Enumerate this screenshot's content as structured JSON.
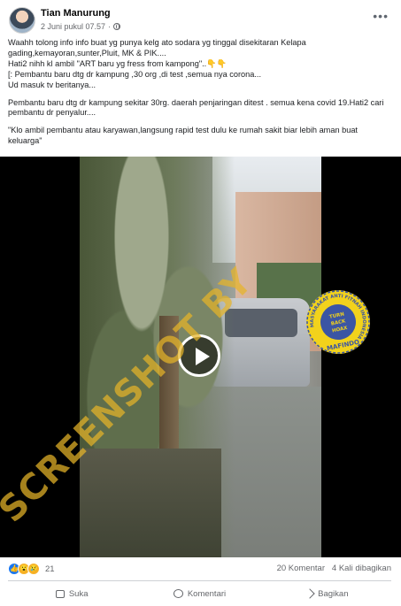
{
  "post": {
    "author": "Tian Manurung",
    "date": "2 Juni pukul 07.57",
    "date_separator": "·",
    "text_lines": [
      "Waahh tolong info info buat yg punya kelg ato sodara yg tinggal disekitaran Kelapa gading,kemayoran,sunter,Pluit, MK & PIK....",
      "Hati2 nihh kl ambil \"ART baru yg fress from kampong\"..👇👇",
      "[: Pembantu baru dtg dr kampung ,30 org ,di test ,semua nya corona...",
      " Ud masuk tv beritanya...",
      "Pembantu baru dtg dr kampung sekitar 30rg. daerah penjaringan ditest . semua kena covid 19.Hati2 cari pembantu dr penyalur....",
      "\"Klo ambil pembantu atau karyawan,langsung rapid test dulu ke rumah sakit biar lebih aman buat keluarga\""
    ]
  },
  "video": {
    "watermark": "SCREENSHOT BY",
    "seal": {
      "ring_text": "MASYARAKAT ANTI FITNAH INDONESIA",
      "center_top": "TURN",
      "center_mid": "BACK",
      "center_bottom": "HOAX",
      "brand": "MAFINDO"
    }
  },
  "stats": {
    "reaction_count": "21",
    "comments": "20 Komentar",
    "shares": "4 Kali dibagikan"
  },
  "actions": {
    "like": "Suka",
    "comment": "Komentari",
    "share": "Bagikan"
  },
  "colors": {
    "like_blue": "#1877f2",
    "watermark": "#e6b428",
    "seal_yellow": "#f2d21c",
    "seal_blue": "#3b55a4"
  }
}
